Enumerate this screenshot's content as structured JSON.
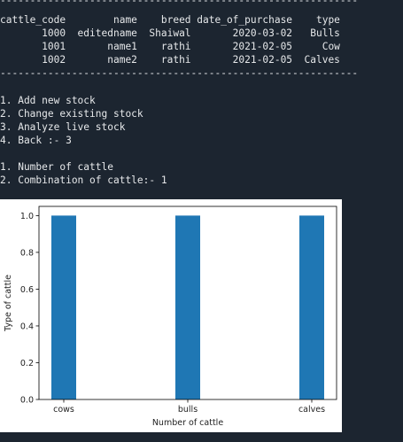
{
  "terminal": {
    "separator_top": "------------------------------------------------------------",
    "table_header": "cattle_code        name    breed date_of_purchase    type",
    "rows": [
      "       1000  editedname  Shaiwal       2020-03-02   Bulls",
      "       1001       name1    rathi       2021-02-05     Cow",
      "       1002       name2    rathi       2021-02-05  Calves"
    ],
    "separator_bottom": "------------------------------------------------------------",
    "menu": [
      "1. Add new stock",
      "2. Change existing stock",
      "3. Analyze live stock",
      "4. Back :- 3"
    ],
    "submenu": [
      "1. Number of cattle",
      "2. Combination of cattle:- 1"
    ]
  },
  "chart_data": {
    "type": "bar",
    "categories": [
      "cows",
      "bulls",
      "calves"
    ],
    "values": [
      1.0,
      1.0,
      1.0
    ],
    "xlabel": "Number of cattle",
    "ylabel": "Type of cattle",
    "ylim": [
      0,
      1.05
    ],
    "yticks": [
      "0.0",
      "0.2",
      "0.4",
      "0.6",
      "0.8",
      "1.0"
    ],
    "grid": false,
    "bar_color": "#1f77b4"
  }
}
